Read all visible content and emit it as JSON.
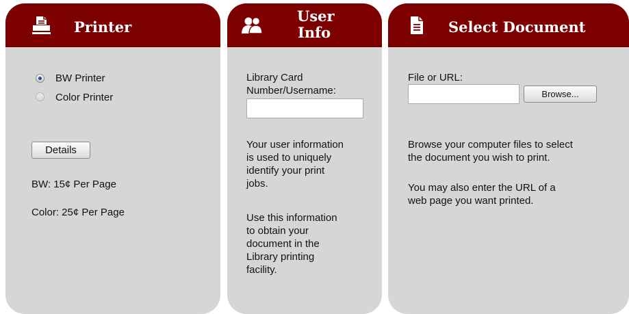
{
  "printer": {
    "title": "Printer",
    "icon": "printer-icon",
    "options": [
      {
        "label": "BW Printer",
        "checked": true
      },
      {
        "label": "Color Printer",
        "checked": false
      }
    ],
    "details_button": "Details",
    "prices": [
      "BW: 15¢ Per Page",
      "Color: 25¢ Per Page"
    ]
  },
  "user_info": {
    "title_line1": "User",
    "title_line2": "Info",
    "icon": "users-icon",
    "field_label_line1": "Library Card",
    "field_label_line2": "Number/Username:",
    "field_value": "",
    "desc1_lines": [
      "Your user information",
      "is used to uniquely",
      "identify your print",
      "jobs."
    ],
    "desc2_lines": [
      "Use this information",
      "to obtain your",
      "document in the",
      "Library printing",
      "facility."
    ]
  },
  "select_document": {
    "title": "Select Document",
    "icon": "document-icon",
    "file_label": "File or URL:",
    "file_value": "",
    "browse_button": "Browse...",
    "desc1_lines": [
      "Browse your computer files to select",
      "the document you wish to print."
    ],
    "desc2_lines": [
      "You may also enter the URL of a",
      "web page you want printed."
    ]
  },
  "colors": {
    "header": "#7d0000",
    "panel": "#d6d6d6"
  }
}
